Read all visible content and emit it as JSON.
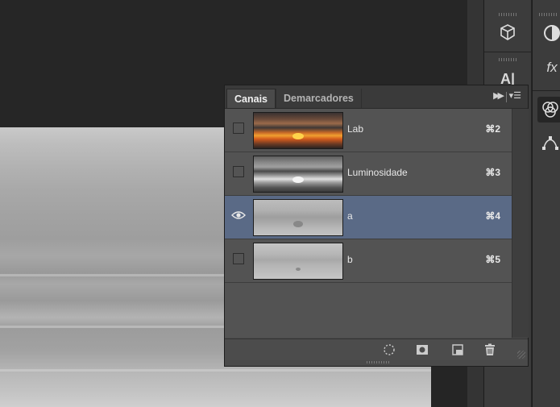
{
  "panel": {
    "tabs": [
      {
        "label": "Canais",
        "active": true
      },
      {
        "label": "Demarcadores",
        "active": false
      }
    ],
    "collapse_glyph": "▶▶",
    "menu_glyph": "▾☰"
  },
  "channels": [
    {
      "name": "Lab",
      "shortcut": "⌘2",
      "visible": false,
      "selected": false,
      "thumb": "color-sunset"
    },
    {
      "name": "Luminosidade",
      "shortcut": "⌘3",
      "visible": false,
      "selected": false,
      "thumb": "gray-sunset"
    },
    {
      "name": "a",
      "shortcut": "⌘4",
      "visible": true,
      "selected": true,
      "thumb": "gray-flat"
    },
    {
      "name": "b",
      "shortcut": "⌘5",
      "visible": false,
      "selected": false,
      "thumb": "gray-flat-light"
    }
  ],
  "footer_icons": [
    "load-selection-icon",
    "save-selection-icon",
    "new-channel-icon",
    "trash-icon"
  ],
  "dock_icons": [
    "3d-icon",
    "adjustments-icon",
    "character-icon",
    "styles-fx-icon",
    "channels-icon",
    "paths-icon"
  ],
  "colors": {
    "selected_row": "#5a6a86",
    "panel_bg": "#4a4a4a",
    "app_bg": "#252525"
  }
}
